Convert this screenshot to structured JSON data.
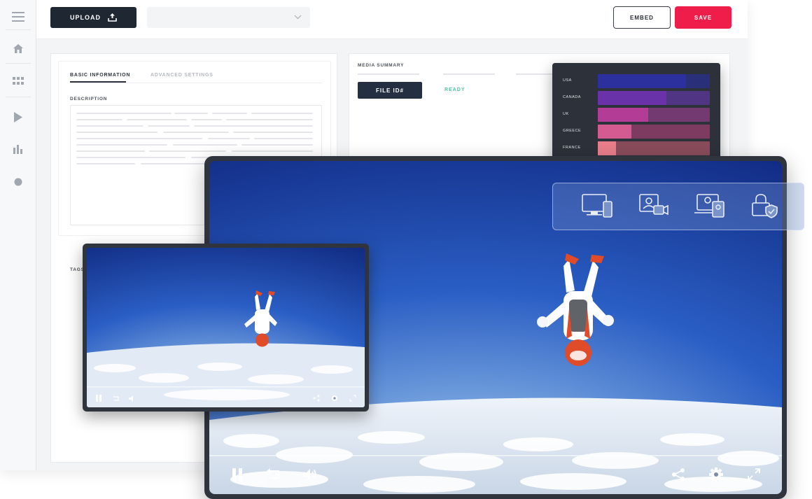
{
  "toolbar": {
    "upload_label": "UPLOAD",
    "embed_label": "EMBED",
    "save_label": "SAVE"
  },
  "sidebar": {
    "items": [
      {
        "icon": "menu-icon"
      },
      {
        "icon": "home-icon"
      },
      {
        "icon": "grid-icon"
      },
      {
        "icon": "play-icon"
      },
      {
        "icon": "analytics-icon"
      },
      {
        "icon": "circle-icon"
      }
    ]
  },
  "details": {
    "tabs": [
      "BASIC INFORMATION",
      "ADVANCED SETTINGS"
    ],
    "description_label": "DESCRIPTION",
    "tags_label": "TAGS"
  },
  "media_summary": {
    "title": "MEDIA SUMMARY",
    "file_id_label": "FILE ID#",
    "status": "READY"
  },
  "stats": {
    "rows": [
      {
        "label": "USA",
        "value": 0.79,
        "fill": "#2c2f9e",
        "track": "#2a2f7a"
      },
      {
        "label": "CANADA",
        "value": 0.61,
        "fill": "#6a32a8",
        "track": "#4f3584"
      },
      {
        "label": "UK",
        "value": 0.45,
        "fill": "#b23c96",
        "track": "#733a72"
      },
      {
        "label": "GREECE",
        "value": 0.3,
        "fill": "#d45b92",
        "track": "#7d3b62"
      },
      {
        "label": "FRANCE",
        "value": 0.16,
        "fill": "#ea7e8a",
        "track": "#8a4c5a"
      }
    ]
  },
  "devices": {
    "icons": [
      "devices-icon",
      "video-call-icon",
      "screen-share-icon",
      "lock-shield-icon"
    ]
  },
  "player": {
    "controls_left": [
      "pause-icon",
      "replay-icon",
      "volume-icon"
    ],
    "controls_right": [
      "share-icon",
      "settings-icon",
      "fullscreen-icon"
    ]
  },
  "colors": {
    "accent": "#ee1d4a",
    "dark": "#1f2733",
    "ready": "#54c1a4"
  }
}
